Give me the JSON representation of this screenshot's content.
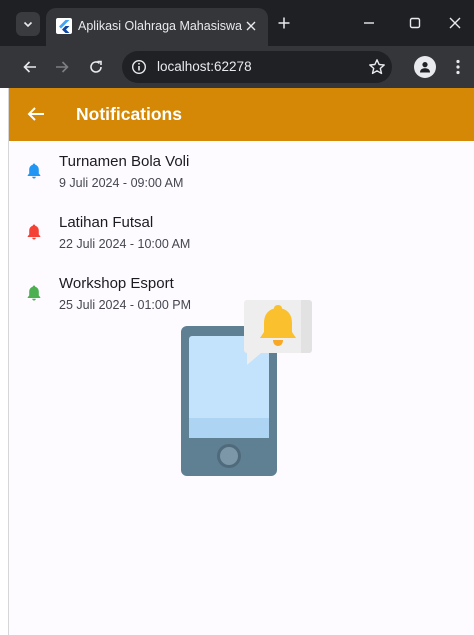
{
  "browser": {
    "tab_title": "Aplikasi Olahraga Mahasiswa",
    "url": "localhost:62278"
  },
  "app": {
    "title": "Notifications",
    "notifications": [
      {
        "title": "Turnamen Bola Voli",
        "date": "9 Juli 2024 - 09:00 AM",
        "color": "#2196f3"
      },
      {
        "title": "Latihan Futsal",
        "date": "22 Juli 2024 - 10:00 AM",
        "color": "#f44336"
      },
      {
        "title": "Workshop Esport",
        "date": "25 Juli 2024 - 01:00 PM",
        "color": "#4caf50"
      }
    ]
  },
  "colors": {
    "appbar": "#d48806",
    "browser_frame": "#1f2023",
    "browser_toolbar": "#35363a"
  },
  "icons": {
    "tab_menu": "chevron-down-icon",
    "favicon": "flutter-icon",
    "tab_close": "close-icon",
    "new_tab": "plus-icon",
    "minimize": "minimize-icon",
    "maximize": "maximize-icon",
    "close_window": "close-icon",
    "back": "arrow-left-icon",
    "forward": "arrow-right-icon",
    "reload": "reload-icon",
    "site_info": "info-icon",
    "bookmark": "star-icon",
    "profile": "person-icon",
    "menu": "more-vert-icon",
    "app_back": "arrow-left-icon",
    "notification": "bell-icon",
    "illustration": "phone-bell-illustration"
  }
}
